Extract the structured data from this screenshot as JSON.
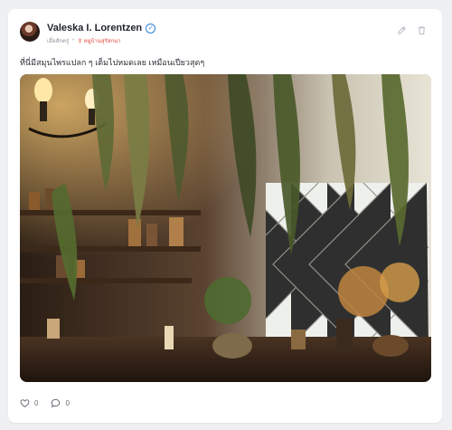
{
  "post": {
    "author": "Valeska I. Lorentzen",
    "timestamp": "เมื่อสักครู่",
    "group_name": "หมู่บ้านสุรัสกนา",
    "text": "ที่นี่มีสมุนไพรแปลก ๆ เต็มไปหมดเลย เหมือนเปียวสุดๆ",
    "image_description": "apothecary-room-with-hanging-herbs",
    "likes": "0",
    "comments": "0"
  },
  "icons": {
    "verified": "verified-badge-icon",
    "group": "group-pin-icon",
    "edit": "pencil-icon",
    "delete": "trash-icon",
    "like": "heart-icon",
    "comment": "comment-bubble-icon"
  },
  "colors": {
    "accent": "#e0463c",
    "verified": "#2f7de1",
    "muted": "#8a8f98"
  }
}
